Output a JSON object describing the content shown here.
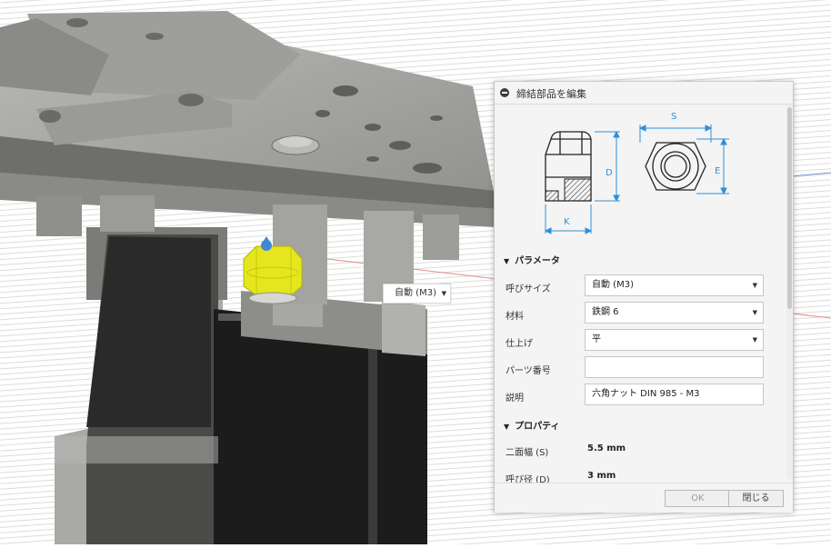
{
  "canvas": {
    "size_dropdown_value": "自動 (M3)"
  },
  "dialog": {
    "title": "締結部品を編集",
    "diagram_labels": {
      "S": "S",
      "D": "D",
      "E": "E",
      "K": "K"
    },
    "sections": {
      "parameters": "パラメータ",
      "properties": "プロパティ"
    },
    "params": {
      "nominal_size_label": "呼びサイズ",
      "nominal_size_value": "自動 (M3)",
      "material_label": "材料",
      "material_value": "鉄鋼 6",
      "finish_label": "仕上げ",
      "finish_value": "平",
      "part_number_label": "パーツ番号",
      "part_number_value": "",
      "description_label": "説明",
      "description_value": "六角ナット DIN 985 - M3"
    },
    "props": {
      "width_across_flats_label": "二面幅 (S)",
      "width_across_flats_value": "5.5 mm",
      "nominal_diameter_label": "呼び径 (D)",
      "nominal_diameter_value": "3 mm"
    },
    "buttons": {
      "ok": "OK",
      "close": "閉じる"
    }
  },
  "colors": {
    "dimension_accent": "#2f8fd8",
    "selected_part": "#e6e61e",
    "motor_body": "#1c1c1c",
    "bracket": "#8f8f8c"
  }
}
